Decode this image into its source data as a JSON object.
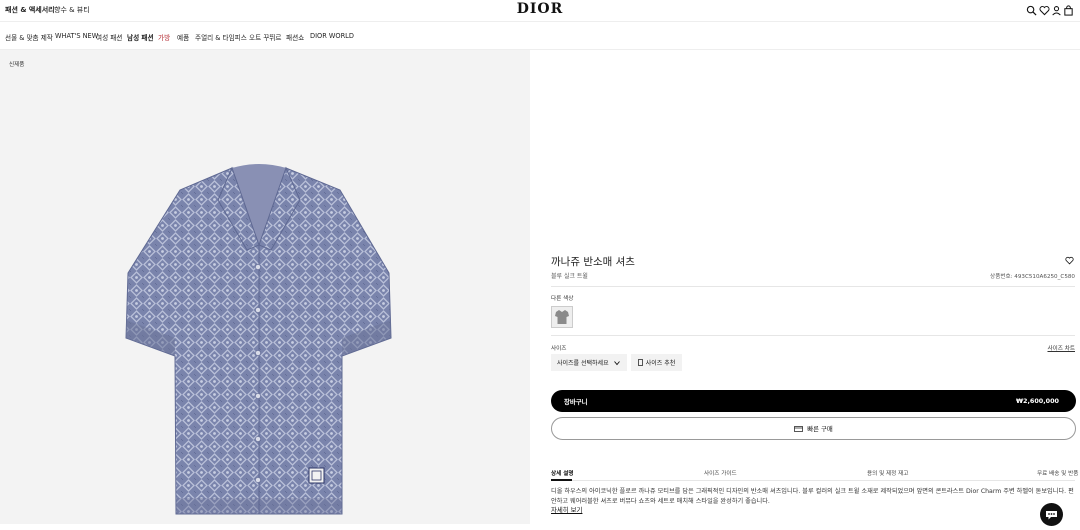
{
  "header": {
    "links": [
      "패션 & 액세서리",
      "향수 & 뷰티"
    ],
    "logo": "DIOR",
    "icons": [
      "search-icon",
      "heart-icon",
      "account-icon",
      "shopping-bag-icon"
    ]
  },
  "nav": {
    "items": [
      "선물 & 맞춤 제작",
      "WHAT'S NEW",
      "여성 패션",
      "남성 패션",
      "가방",
      "예품",
      "주얼리 & 타임피스",
      "오트 꾸뛰르",
      "패션쇼",
      "DIOR WORLD"
    ]
  },
  "gallery": {
    "badge": "신제품",
    "image": "short-sleeve-shirt"
  },
  "product": {
    "title": "까나쥬 반소매 셔츠",
    "subtitle": "블루 실크 트윌",
    "code": "상품번호: 493C510A6250_C580",
    "colors_label": "다른 색상",
    "size_label": "사이즈",
    "size_chart": "사이즈 차트",
    "size_select": "사이즈를 선택하세요",
    "size_recommend": "사이즈 추천",
    "cart_label": "장바구니",
    "price": "₩2,600,000",
    "quick_buy": "빠른 구매"
  },
  "tabs": [
    "상세 설명",
    "사이즈 가이드",
    "용의 및 제정 재고",
    "무료 배송 및 반품"
  ],
  "description": {
    "text": "디올 하우스의 아이코닉한 플로르 까나쥬 모티브를 담은 그래픽적인 디자인의 반소매 셔츠입니다. 블루 컬러의 실크 트윌 소재로 제작되었으며 앞면의 콘트라스트 Dior Charm 주변 하벨이 돋보입니다. 편안하고 웨어러블한 셔츠로 버뮤다 쇼츠와 세트로 매치해 스타일을 완성하기 좋습니다.",
    "more": "자세히 보기"
  },
  "colors": {
    "shirt": "#7a84ac",
    "shirt_dark": "#5e6892",
    "shirt_light": "#b9c0d9",
    "accent": "#b3272f"
  }
}
